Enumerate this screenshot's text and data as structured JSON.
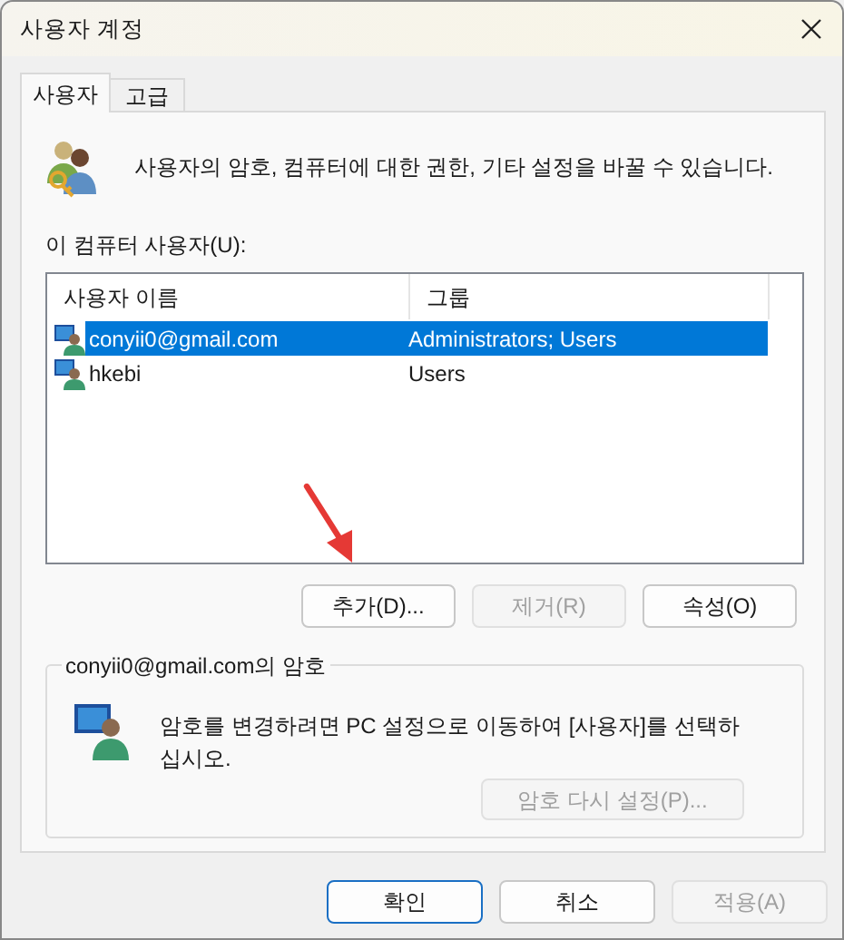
{
  "window": {
    "title": "사용자 계정"
  },
  "tabs": [
    {
      "label": "사용자",
      "selected": true
    },
    {
      "label": "고급",
      "selected": false
    }
  ],
  "description": "사용자의 암호, 컴퓨터에 대한 권한, 기타 설정을 바꿀 수 있습니다.",
  "users_label": "이 컴퓨터 사용자(U):",
  "users_table": {
    "columns": [
      "사용자 이름",
      "그룹"
    ],
    "rows": [
      {
        "cells": [
          "conyii0@gmail.com",
          "Administrators; Users"
        ],
        "selected": true
      },
      {
        "cells": [
          "hkebi",
          "Users"
        ],
        "selected": false
      }
    ]
  },
  "list_buttons": [
    {
      "label": "추가(D)...",
      "disabled": false
    },
    {
      "label": "제거(R)",
      "disabled": true
    },
    {
      "label": "속성(O)",
      "disabled": false
    }
  ],
  "password_group": {
    "title": "conyii0@gmail.com의 암호",
    "text": "암호를 변경하려면 PC 설정으로 이동하여 [사용자]를 선택하십시오.",
    "reset_button": {
      "label": "암호 다시 설정(P)...",
      "disabled": true
    }
  },
  "dialog_buttons": [
    {
      "label": "확인",
      "disabled": false,
      "default": true
    },
    {
      "label": "취소",
      "disabled": false,
      "default": false
    },
    {
      "label": "적용(A)",
      "disabled": true,
      "default": false
    }
  ]
}
